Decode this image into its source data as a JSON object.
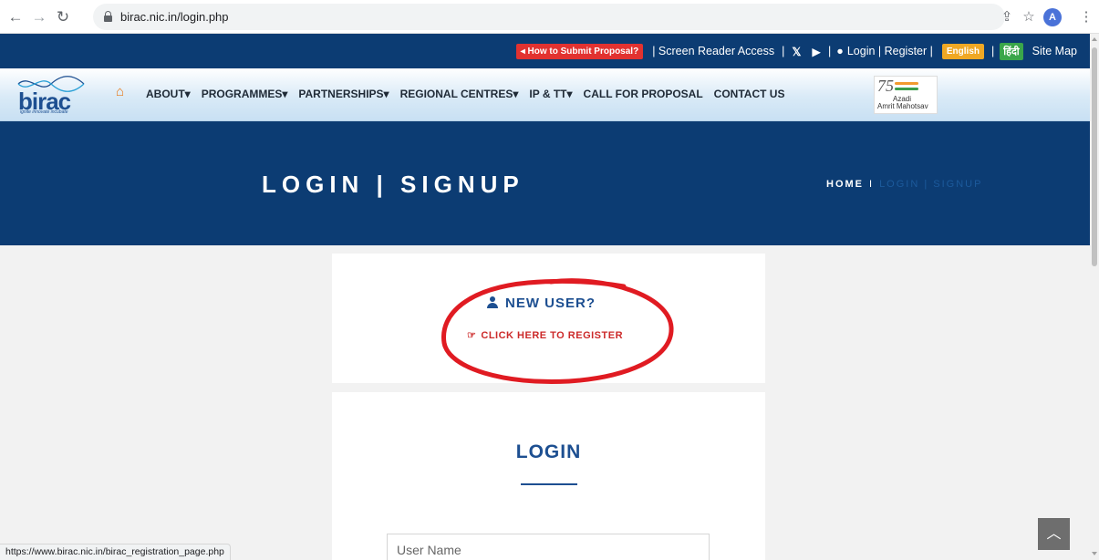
{
  "browser": {
    "url": "birac.nic.in/login.php",
    "profile_initial": "A",
    "status_url": "https://www.birac.nic.in/birac_registration_page.php"
  },
  "top_bar": {
    "proposal_button": "How to Submit Proposal?",
    "screen_reader": "| Screen Reader Access",
    "login_register": "Login | Register |",
    "english": "English",
    "hindi": "हिंदी",
    "site_map": "Site Map"
  },
  "logo": {
    "word": "birac",
    "tagline": "ignite innovate incubate"
  },
  "nav": {
    "items": [
      {
        "label": "ABOUT"
      },
      {
        "label": "PROGRAMMES"
      },
      {
        "label": "PARTNERSHIPS"
      },
      {
        "label": "REGIONAL CENTRES"
      },
      {
        "label": "IP & TT"
      },
      {
        "label": "CALL FOR PROPOSAL"
      },
      {
        "label": "CONTACT US"
      }
    ],
    "dropdown_marker": "▾",
    "azadi_line1": "Azadi",
    "azadi_line2": "Amrit Mahotsav",
    "azadi_number": "75"
  },
  "banner": {
    "title": "LOGIN | SIGNUP",
    "breadcrumb_home": "HOME",
    "breadcrumb_sep": "I",
    "breadcrumb_current": "LOGIN | SIGNUP"
  },
  "register_card": {
    "heading": "NEW USER?",
    "link": "CLICK HERE TO REGISTER"
  },
  "login_card": {
    "title": "LOGIN",
    "username_placeholder": "User Name"
  },
  "colors": {
    "navy": "#0c3c73",
    "accent_red": "#e23230",
    "brand_blue": "#1d4f91",
    "link_red": "#cc2a2a"
  }
}
